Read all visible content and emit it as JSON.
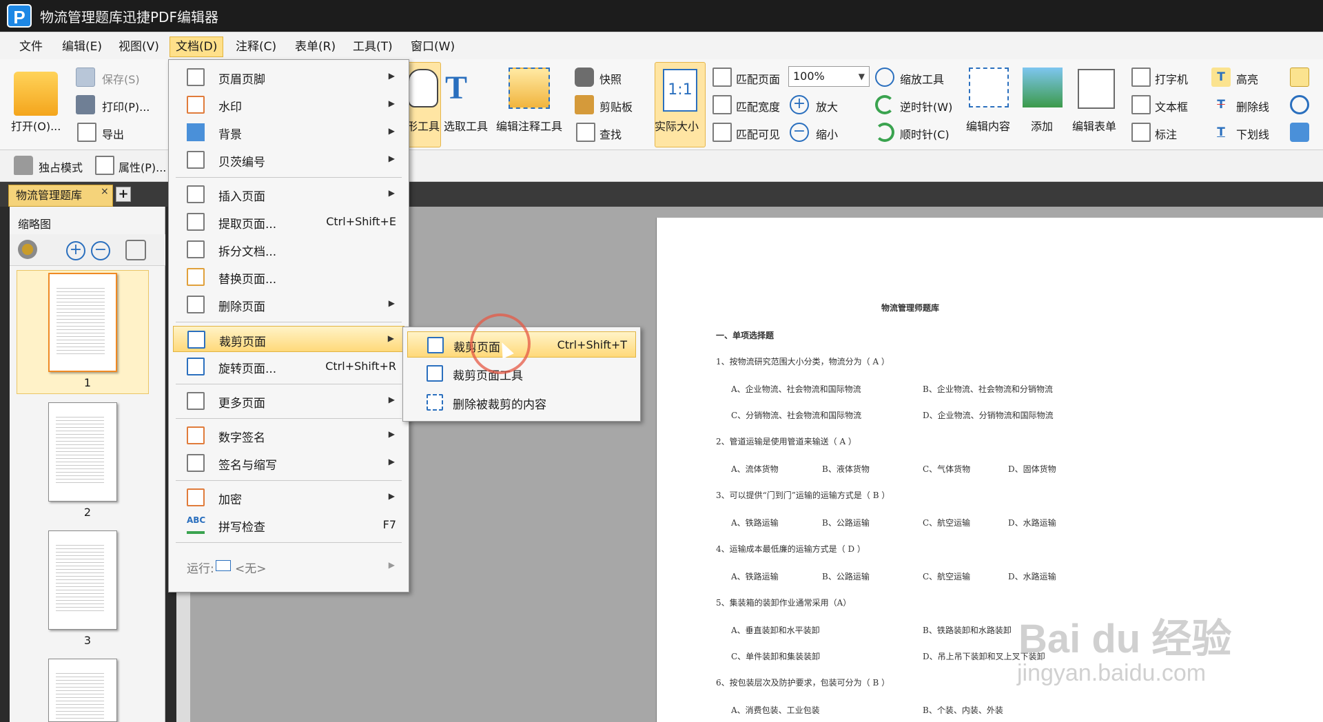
{
  "app": {
    "title": "物流管理题库迅捷PDF编辑器",
    "logo_letter": "P"
  },
  "menubar": [
    {
      "label": "文件"
    },
    {
      "label": "编辑(E)"
    },
    {
      "label": "视图(V)"
    },
    {
      "label": "文档(D)"
    },
    {
      "label": "注释(C)"
    },
    {
      "label": "表单(R)"
    },
    {
      "label": "工具(T)"
    },
    {
      "label": "窗口(W)"
    }
  ],
  "ribbon": {
    "open": "打开(O)...",
    "save": "保存(S)",
    "print": "打印(P)...",
    "export": "导出",
    "hand_tool_partial": "形工具",
    "select_tool": "选取工具",
    "edit_annotation": "编辑注释工具",
    "snapshot": "快照",
    "clipboard": "剪贴板",
    "find": "查找",
    "actual_size": "实际大小",
    "actual_size_icon": "1:1",
    "fit_page": "匹配页面",
    "fit_width": "匹配宽度",
    "fit_visible": "匹配可见",
    "zoom_value": "100%",
    "zoom_in": "放大",
    "zoom_out": "缩小",
    "zoom_tool": "缩放工具",
    "rotate_ccw": "逆时针(W)",
    "rotate_cw": "顺时针(C)",
    "edit_content": "编辑内容",
    "add": "添加",
    "edit_form": "编辑表单",
    "typewriter": "打字机",
    "textbox": "文本框",
    "callout": "标注",
    "highlight": "高亮",
    "strikeout": "删除线",
    "underline": "下划线",
    "exclusive_mode": "独占模式",
    "properties": "属性(P)..."
  },
  "tabs": {
    "doc_tab": "物流管理题库",
    "close": "×",
    "add": "+"
  },
  "thumbnails": {
    "header": "缩略图",
    "pages": [
      "1",
      "2",
      "3"
    ]
  },
  "doc_menu": {
    "items": [
      {
        "label": "页眉页脚",
        "shortcut": "",
        "submenu": true
      },
      {
        "label": "水印",
        "shortcut": "",
        "submenu": true
      },
      {
        "label": "背景",
        "shortcut": "",
        "submenu": true
      },
      {
        "label": "贝茨编号",
        "shortcut": "",
        "submenu": true
      },
      {
        "label": "插入页面",
        "shortcut": "",
        "submenu": true
      },
      {
        "label": "提取页面...",
        "shortcut": "Ctrl+Shift+E",
        "submenu": false
      },
      {
        "label": "拆分文档...",
        "shortcut": "",
        "submenu": false
      },
      {
        "label": "替换页面...",
        "shortcut": "",
        "submenu": false
      },
      {
        "label": "删除页面",
        "shortcut": "",
        "submenu": true
      },
      {
        "label": "裁剪页面",
        "shortcut": "",
        "submenu": true
      },
      {
        "label": "旋转页面...",
        "shortcut": "Ctrl+Shift+R",
        "submenu": false
      },
      {
        "label": "更多页面",
        "shortcut": "",
        "submenu": true
      },
      {
        "label": "数字签名",
        "shortcut": "",
        "submenu": true
      },
      {
        "label": "签名与缩写",
        "shortcut": "",
        "submenu": true
      },
      {
        "label": "加密",
        "shortcut": "",
        "submenu": true
      },
      {
        "label": "拼写检查",
        "shortcut": "F7",
        "submenu": false
      },
      {
        "label": "运行: ",
        "shortcut": "",
        "submenu": true
      }
    ],
    "run_value": "<无>",
    "spell_icon_text": "ABC"
  },
  "crop_submenu": {
    "items": [
      {
        "label": "裁剪页面",
        "shortcut": "Ctrl+Shift+T"
      },
      {
        "label": "裁剪页面工具",
        "shortcut": ""
      },
      {
        "label": "删除被裁剪的内容",
        "shortcut": ""
      }
    ]
  },
  "document": {
    "title": "物流管理师题库",
    "section": "一、单项选择题",
    "q1": "1、按物流研究范围大小分类，物流分为（ A ）",
    "q1a": "A、企业物流、社会物流和国际物流",
    "q1b": "B、企业物流、社会物流和分销物流",
    "q1c": "C、分销物流、社会物流和国际物流",
    "q1d": "D、企业物流、分销物流和国际物流",
    "q2": "2、管道运输是使用管道来输送（ A ）",
    "q2a": "A、流体货物",
    "q2b": "B、液体货物",
    "q2c": "C、气体货物",
    "q2d": "D、固体货物",
    "q3": "3、可以提供“门到门”运输的运输方式是（ B ）",
    "q3a": "A、铁路运输",
    "q3b": "B、公路运输",
    "q3c": "C、航空运输",
    "q3d": "D、水路运输",
    "q4": "4、运输成本最低廉的运输方式是（ D ）",
    "q4a": "A、铁路运输",
    "q4b": "B、公路运输",
    "q4c": "C、航空运输",
    "q4d": "D、水路运输",
    "q5": "5、集装箱的装卸作业通常采用（A）",
    "q5a": "A、垂直装卸和水平装卸",
    "q5b": "B、铁路装卸和水路装卸",
    "q5c": "C、单件装卸和集装装卸",
    "q5d": "D、吊上吊下装卸和叉上叉下装卸",
    "q6": "6、按包装层次及防护要求，包装可分为（ B ）",
    "q6a": "A、消费包装、工业包装",
    "q6b": "B、个装、内装、外装"
  },
  "watermark": {
    "brand": "Bai du 经验",
    "url": "jingyan.baidu.com"
  }
}
